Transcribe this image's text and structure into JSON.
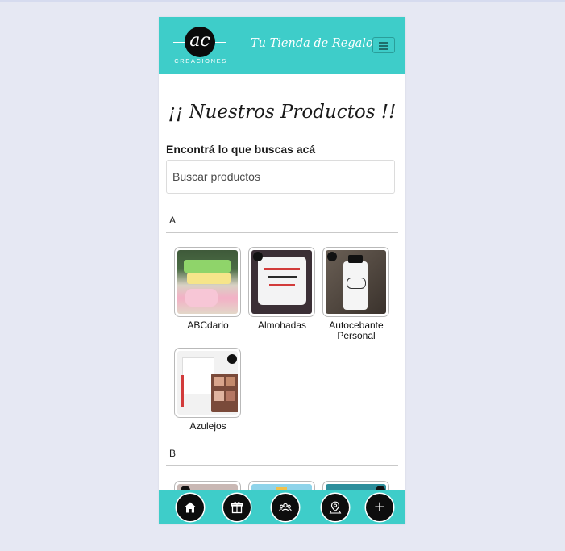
{
  "header": {
    "logo_monogram": "ac",
    "logo_text": "CREACIONES",
    "tagline": "Tu Tienda de Regalos"
  },
  "main": {
    "title": "¡¡ Nuestros Productos !!",
    "search_label": "Encontrá lo que buscas acá",
    "search_placeholder": "Buscar productos"
  },
  "sections": [
    {
      "letter": "A",
      "products": [
        {
          "name": "ABCdario"
        },
        {
          "name": "Almohadas"
        },
        {
          "name": "Autocebante Personal"
        },
        {
          "name": "Azulejos"
        }
      ]
    },
    {
      "letter": "B",
      "products": []
    }
  ],
  "bottom_nav": {
    "icons": [
      "home-icon",
      "gift-shop-icon",
      "group-icon",
      "location-pin-icon",
      "plus-icon"
    ],
    "plus_glyph": "+"
  },
  "colors": {
    "brand": "#3ecdc9",
    "page_background": "#e6e8f3",
    "nav_button": "#0d0d0d"
  }
}
